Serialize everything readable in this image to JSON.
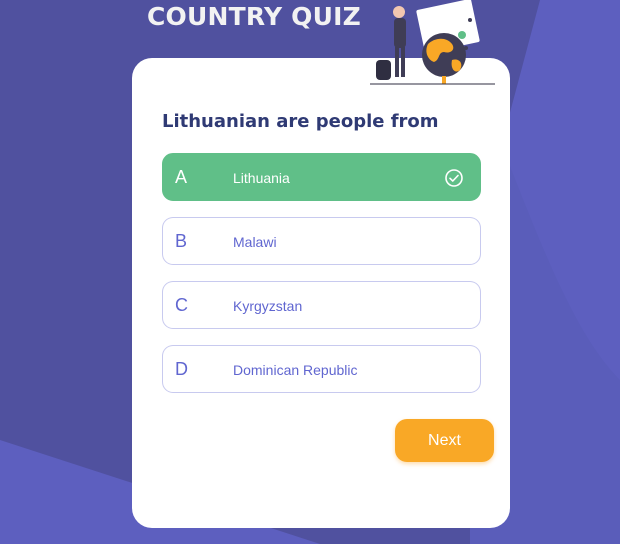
{
  "app": {
    "title": "COUNTRY QUIZ"
  },
  "colors": {
    "background": "#5d5fbf",
    "correct": "#60bf88",
    "accent": "#f9a826",
    "option_text": "#6066d0",
    "question_text": "#2f3a74"
  },
  "quiz": {
    "question": "Lithuanian are people from",
    "options": [
      {
        "letter": "A",
        "label": "Lithuania",
        "state": "correct"
      },
      {
        "letter": "B",
        "label": "Malawi",
        "state": "default"
      },
      {
        "letter": "C",
        "label": "Kyrgyzstan",
        "state": "default"
      },
      {
        "letter": "D",
        "label": "Dominican Republic",
        "state": "default"
      }
    ],
    "next_label": "Next"
  },
  "icons": {
    "illustration": "traveler-globe-illustration",
    "check": "check-circle-icon"
  }
}
